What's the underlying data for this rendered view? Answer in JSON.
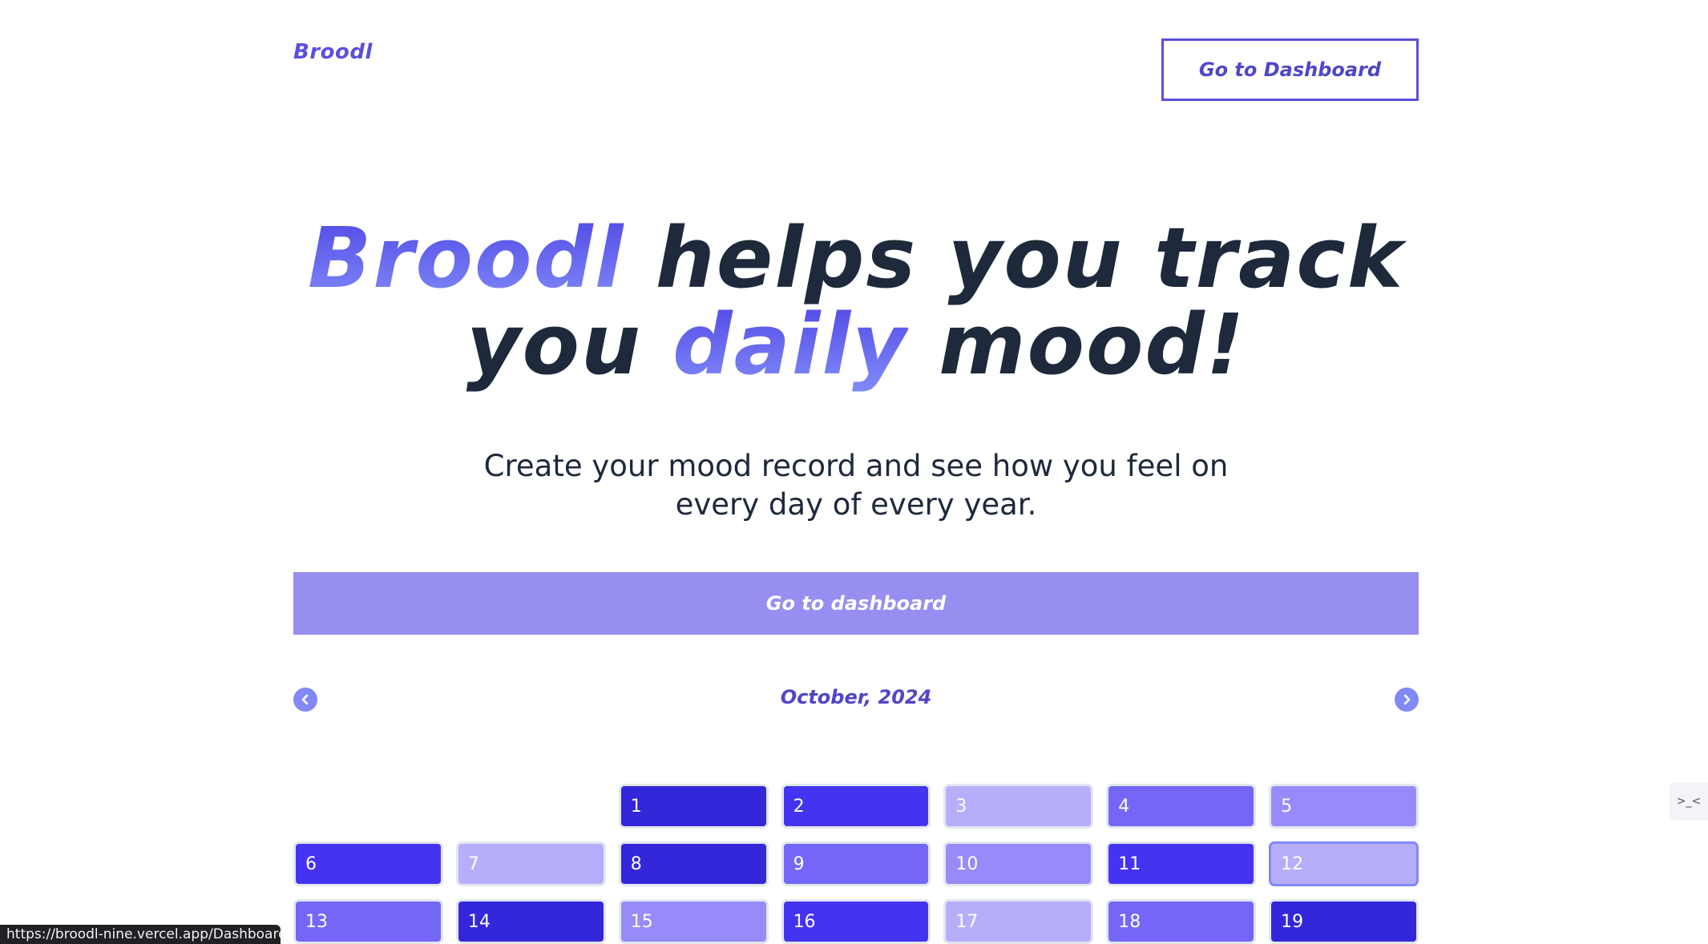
{
  "header": {
    "brand": "Broodl",
    "dashboard_button": "Go to Dashboard"
  },
  "hero": {
    "line1_highlight": "Broodl",
    "line1_rest": " helps you track",
    "line2_start": "you ",
    "line2_highlight": "daily",
    "line2_end": " mood!"
  },
  "subtitle": {
    "line1": "Create your mood record and see how you feel on",
    "line2": "every day of every year."
  },
  "cta": {
    "label": "Go to dashboard"
  },
  "calendar": {
    "month_label": "October, 2024",
    "prev_icon": "chevron-left-icon",
    "next_icon": "chevron-right-icon",
    "leading_blanks": 2,
    "days": [
      {
        "day": "1",
        "color": "#3426d9"
      },
      {
        "day": "2",
        "color": "#4533f2"
      },
      {
        "day": "3",
        "color": "#b7aefb"
      },
      {
        "day": "4",
        "color": "#7467f8"
      },
      {
        "day": "5",
        "color": "#968bf8"
      },
      {
        "day": "6",
        "color": "#4533f2"
      },
      {
        "day": "7",
        "color": "#b7aefb"
      },
      {
        "day": "8",
        "color": "#3426d9"
      },
      {
        "day": "9",
        "color": "#7467f8"
      },
      {
        "day": "10",
        "color": "#968bf8"
      },
      {
        "day": "11",
        "color": "#4533f2"
      },
      {
        "day": "12",
        "color": "#b7aefb",
        "today": true
      },
      {
        "day": "13",
        "color": "#7467f8"
      },
      {
        "day": "14",
        "color": "#3426d9"
      },
      {
        "day": "15",
        "color": "#968bf8"
      },
      {
        "day": "16",
        "color": "#4533f2"
      },
      {
        "day": "17",
        "color": "#b7aefb"
      },
      {
        "day": "18",
        "color": "#7467f8"
      },
      {
        "day": "19",
        "color": "#3426d9"
      }
    ]
  },
  "status_bar": {
    "url": "https://broodl-nine.vercel.app/Dashboard"
  },
  "side_widget": {
    "glyph": ">_<"
  },
  "colors": {
    "accent": "#5b4fdc",
    "cta_bg": "#968ef0",
    "text_dark": "#1e293b"
  }
}
